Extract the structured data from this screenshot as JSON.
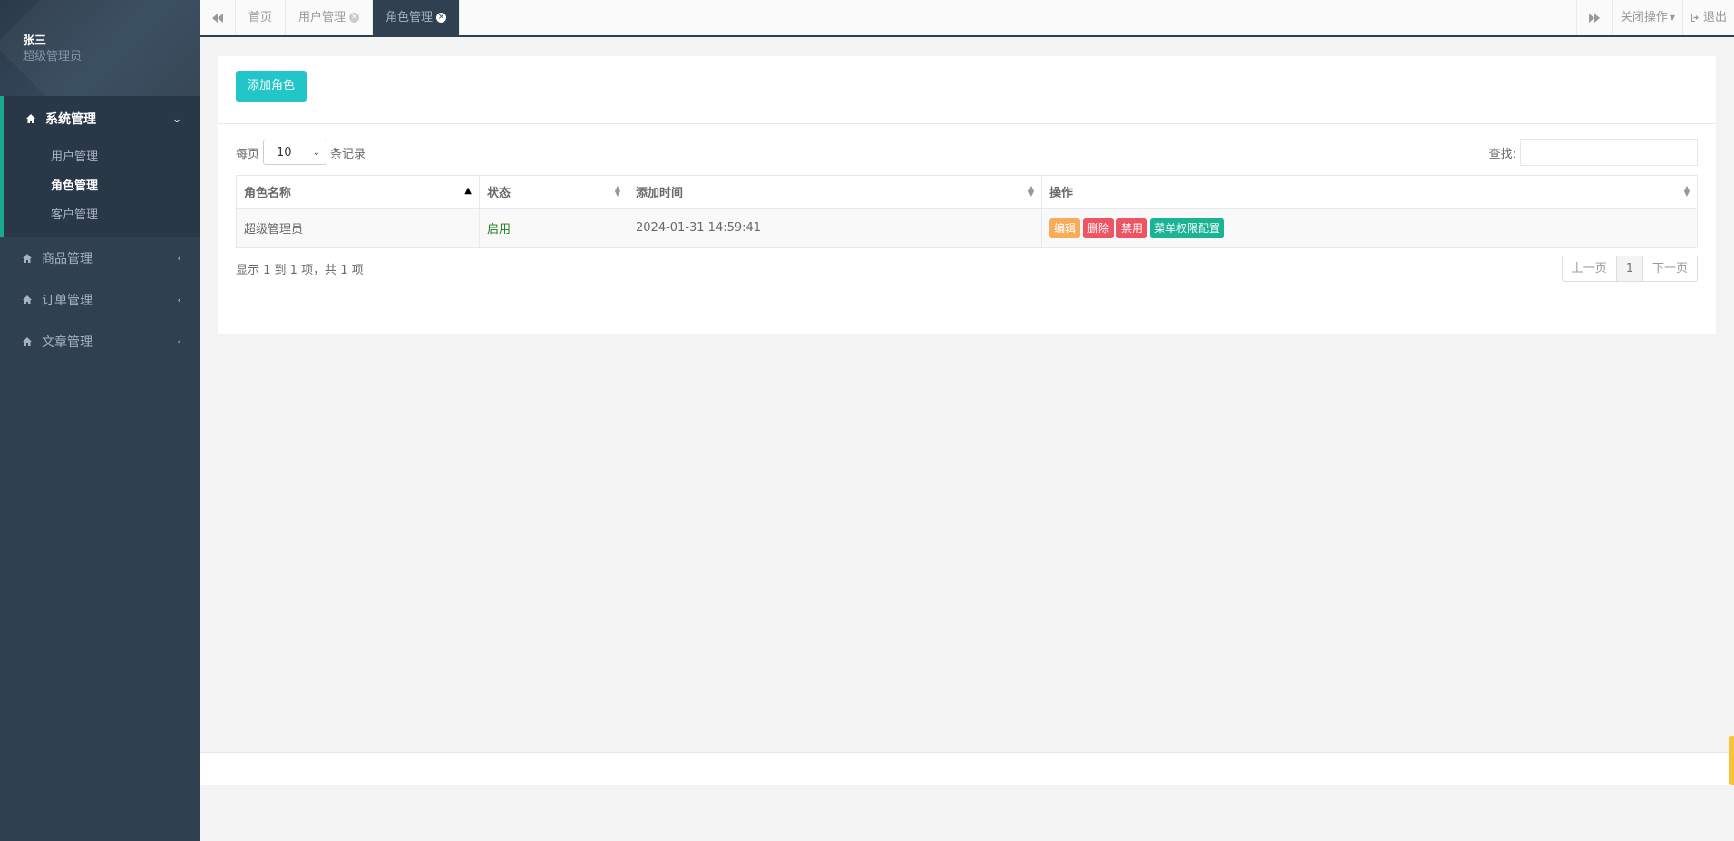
{
  "user": {
    "name": "张三",
    "role": "超级管理员"
  },
  "sidebar": {
    "groups": [
      {
        "label": "系统管理",
        "arrow": "⌄",
        "items": [
          {
            "label": "用户管理"
          },
          {
            "label": "角色管理"
          },
          {
            "label": "客户管理"
          }
        ]
      },
      {
        "label": "商品管理",
        "arrow": "‹"
      },
      {
        "label": "订单管理",
        "arrow": "‹"
      },
      {
        "label": "文章管理",
        "arrow": "‹"
      }
    ]
  },
  "tabs": [
    {
      "label": "首页"
    },
    {
      "label": "用户管理"
    },
    {
      "label": "角色管理"
    }
  ],
  "topbar": {
    "close_ops": "关闭操作",
    "logout": "退出"
  },
  "toolbar": {
    "add_label": "添加角色"
  },
  "table_controls": {
    "per_page": "每页",
    "per_page_value": "10",
    "records": "条记录",
    "search_label": "查找:"
  },
  "table": {
    "columns": [
      "角色名称",
      "状态",
      "添加时间",
      "操作"
    ],
    "rows": [
      {
        "name": "超级管理员",
        "status": "启用",
        "time": "2024-01-31 14:59:41",
        "actions": [
          "编辑",
          "删除",
          "禁用",
          "菜单权限配置"
        ]
      }
    ]
  },
  "footer_info": {
    "summary": "显示 1 到 1 项，共 1 项"
  },
  "pagination": {
    "prev": "上一页",
    "current": "1",
    "next": "下一页"
  },
  "colors": {
    "sidebar": "#2f4050",
    "accent": "#19aa8d",
    "add_button": "#23c6c8",
    "edit": "#f8ac59",
    "danger": "#ed5565",
    "primary": "#1ab394"
  }
}
